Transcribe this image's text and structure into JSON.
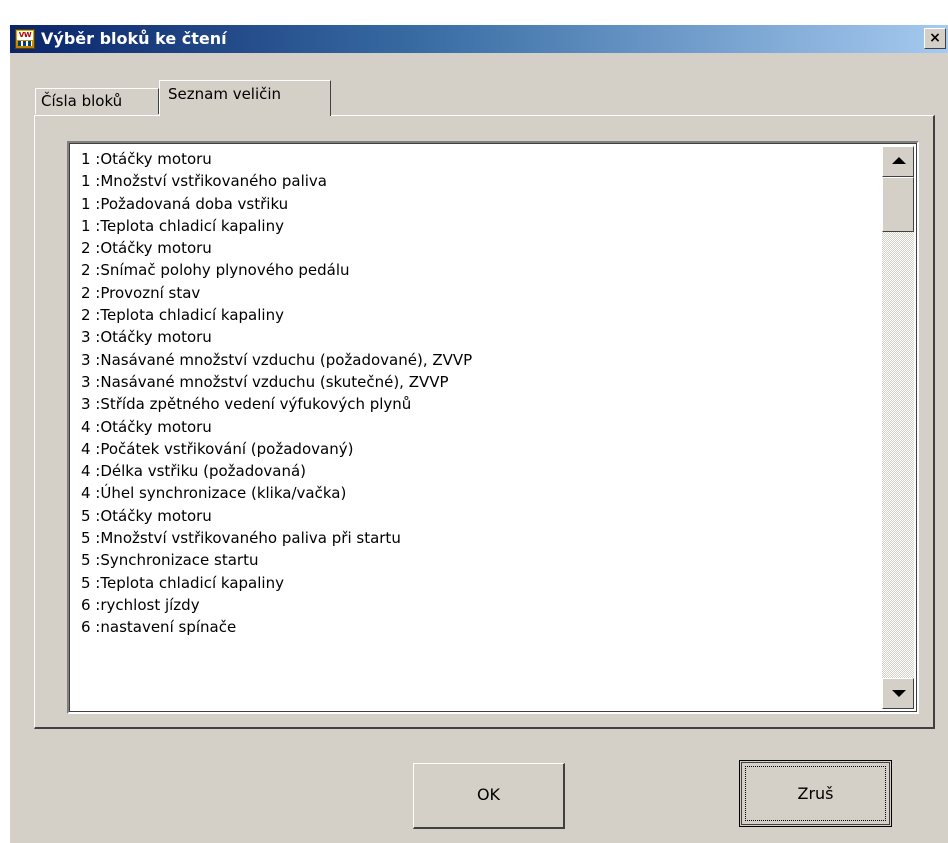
{
  "window": {
    "title": "Výběr bloků ke čtení",
    "close_label": "×",
    "app_icon_text": "VW",
    "app_icon": "vw-app-icon"
  },
  "tabs": [
    {
      "label": "Čísla bloků",
      "active": false
    },
    {
      "label": "Seznam veličin",
      "active": true
    }
  ],
  "list": {
    "items": [
      "1 :Otáčky motoru",
      "1 :Množství vstřikovaného paliva",
      "1 :Požadovaná doba vstřiku",
      "1 :Teplota chladicí kapaliny",
      "2 :Otáčky motoru",
      "2 :Snímač polohy plynového pedálu",
      "2 :Provozní stav",
      "2 :Teplota chladicí kapaliny",
      "3 :Otáčky motoru",
      "3 :Nasávané množství vzduchu (požadované), ZVVP",
      "3 :Nasávané množství vzduchu (skutečné), ZVVP",
      "3 :Střída zpětného vedení výfukových plynů",
      "4 :Otáčky motoru",
      "4 :Počátek vstřikování (požadovaný)",
      "4 :Délka vstřiku (požadovaná)",
      "4 :Úhel synchronizace (klika/vačka)",
      "5 :Otáčky motoru",
      "5 :Množství vstřikovaného paliva při startu",
      "5 :Synchronizace startu",
      "5 :Teplota chladicí kapaliny",
      "6 :rychlost jízdy",
      "6 :nastavení spínače"
    ]
  },
  "buttons": {
    "ok_label": "OK",
    "cancel_label": "Zruš"
  },
  "icons": {
    "scroll_up": "arrow-up-icon",
    "scroll_down": "arrow-down-icon",
    "close": "close-icon"
  }
}
